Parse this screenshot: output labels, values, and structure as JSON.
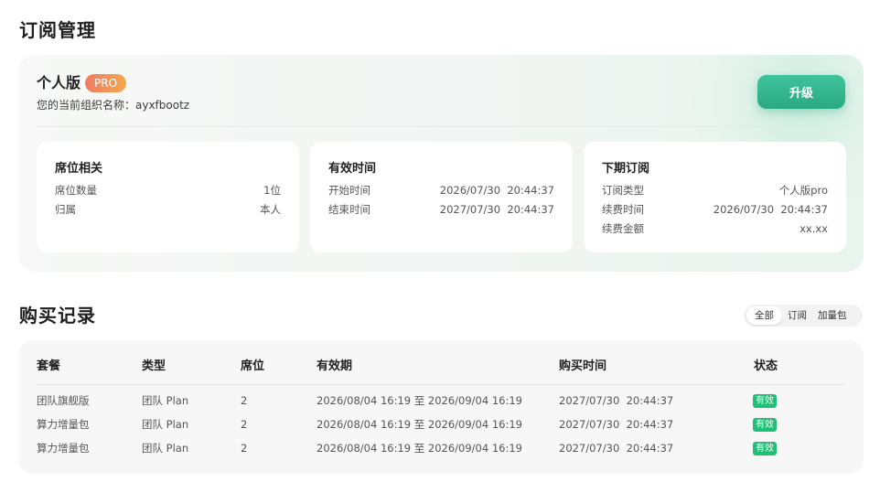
{
  "page_title": "订阅管理",
  "plan": {
    "name": "个人版",
    "badge": "PRO",
    "org_line": "您的当前组织名称：ayxfbootz",
    "upgrade_label": "升级"
  },
  "boxes": {
    "seats": {
      "title": "席位相关",
      "rows": [
        {
          "label": "席位数量",
          "value": "1位"
        },
        {
          "label": "归属",
          "value": "本人"
        }
      ]
    },
    "validity": {
      "title": "有效时间",
      "rows": [
        {
          "label": "开始时间",
          "value": "2026/07/30  20:44:37"
        },
        {
          "label": "结束时间",
          "value": "2027/07/30  20:44:37"
        }
      ]
    },
    "next": {
      "title": "下期订阅",
      "rows": [
        {
          "label": "订阅类型",
          "value": "个人版pro"
        },
        {
          "label": "续费时间",
          "value": "2026/07/30  20:44:37"
        },
        {
          "label": "续费金额",
          "value": "xx.xx"
        }
      ]
    }
  },
  "records": {
    "title": "购买记录",
    "filters": [
      "全部",
      "订阅",
      "加量包"
    ],
    "active_filter": "全部",
    "columns": [
      "套餐",
      "类型",
      "席位",
      "有效期",
      "购买时间",
      "状态"
    ],
    "rows": [
      {
        "package": "团队旗舰版",
        "type": "团队 Plan",
        "seats": "2",
        "period": "2026/08/04 16:19 至 2026/09/04 16:19",
        "purchase_time": "2027/07/30  20:44:37",
        "status": "有效"
      },
      {
        "package": "算力增量包",
        "type": "团队 Plan",
        "seats": "2",
        "period": "2026/08/04 16:19 至 2026/09/04 16:19",
        "purchase_time": "2027/07/30  20:44:37",
        "status": "有效"
      },
      {
        "package": "算力增量包",
        "type": "团队 Plan",
        "seats": "2",
        "period": "2026/08/04 16:19 至 2026/09/04 16:19",
        "purchase_time": "2027/07/30  20:44:37",
        "status": "有效"
      }
    ]
  },
  "colors": {
    "accent": "#2aa982",
    "status_active": "#1fbf76",
    "pro_badge_start": "#f27a63",
    "pro_badge_end": "#f3a94a"
  }
}
